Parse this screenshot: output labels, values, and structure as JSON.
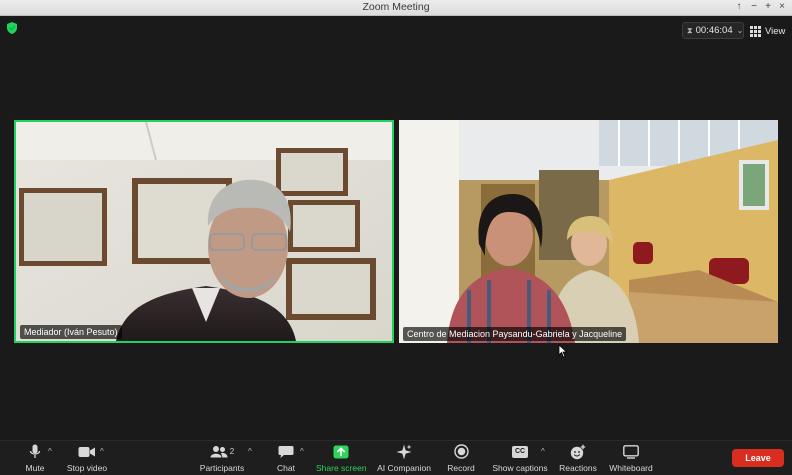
{
  "window": {
    "title": "Zoom Meeting",
    "controls": [
      "↑",
      "−",
      "+",
      "×"
    ]
  },
  "meeting": {
    "timer": "00:46:04",
    "view_label": "View",
    "accent_green": "#23d160",
    "leave_red": "#d92d20"
  },
  "participants_video": [
    {
      "name": "Mediador (Iván Pesuto)",
      "active_speaker": true
    },
    {
      "name": "Centro de Mediacion Paysandu-Gabriela y Jacqueline",
      "active_speaker": false
    }
  ],
  "toolbar": {
    "mute": "Mute",
    "stop_video": "Stop video",
    "participants": "Participants",
    "participants_count": "2",
    "chat": "Chat",
    "share_screen": "Share screen",
    "ai_companion": "AI Companion",
    "record": "Record",
    "show_captions": "Show captions",
    "cc_badge": "CC",
    "reactions": "Reactions",
    "whiteboard": "Whiteboard",
    "leave": "Leave"
  }
}
